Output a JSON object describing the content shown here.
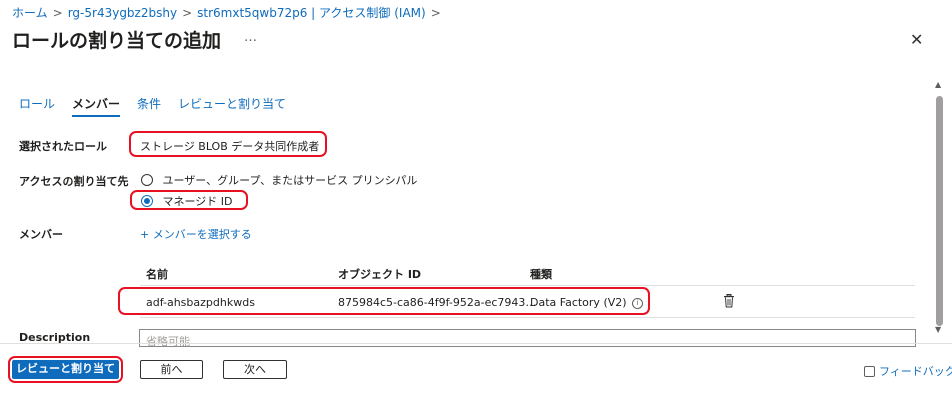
{
  "breadcrumb": {
    "items": [
      "ホーム",
      "rg-5r43ygbz2bshy",
      "str6mxt5qwb72p6 | アクセス制御 (IAM)"
    ],
    "separator": ">"
  },
  "header": {
    "title": "ロールの割り当ての追加",
    "more": "…",
    "close": "✕"
  },
  "tabs": [
    {
      "label": "ロール"
    },
    {
      "label": "メンバー"
    },
    {
      "label": "条件"
    },
    {
      "label": "レビューと割り当て"
    }
  ],
  "form": {
    "selected_role": {
      "label": "選択されたロール",
      "value": "ストレージ BLOB データ共同作成者"
    },
    "assign_access": {
      "label": "アクセスの割り当て先",
      "options": [
        "ユーザー、グループ、またはサービス プリンシパル",
        "マネージド ID"
      ],
      "selected": "マネージド ID"
    },
    "members": {
      "label": "メンバー",
      "select_link": "+ メンバーを選択する"
    },
    "table": {
      "headers": [
        "名前",
        "オブジェクト ID",
        "種類"
      ],
      "rows": [
        {
          "name": "adf-ahsbazpdhkwds",
          "object_id": "875984c5-ca86-4f9f-952a-ec7943…",
          "type": "Data Factory (V2)"
        }
      ]
    },
    "description": {
      "label": "Description",
      "placeholder": "省略可能"
    }
  },
  "footer": {
    "review_assign": "レビューと割り当て",
    "prev": "前へ",
    "next": "次へ",
    "feedback": "フィードバック"
  },
  "colors": {
    "accent": "#0f6cbd",
    "highlight": "#e81123"
  }
}
